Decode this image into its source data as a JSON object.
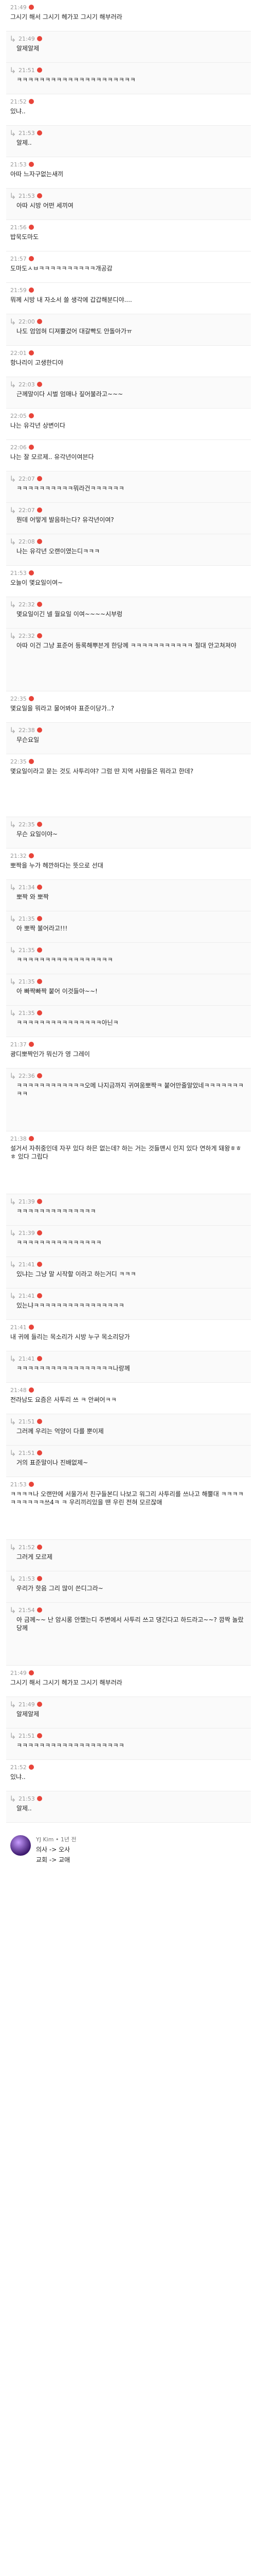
{
  "posts": [
    {
      "reply": false,
      "time": "21:49",
      "text": "그시기 해서 그시기 헤가꼬 그시기 해부러라",
      "tall": false
    },
    {
      "reply": true,
      "time": "21:49",
      "text": "알제알제",
      "tall": false
    },
    {
      "reply": true,
      "time": "21:51",
      "text": "ㅋㅋㅋㅋㅋㅋㅋㅋㅋㅋㅋㅋㅋㅋㅋㅋㅋㅋㅋㅋㅋ",
      "tall": false
    },
    {
      "reply": false,
      "time": "21:52",
      "text": "있냐..",
      "tall": false
    },
    {
      "reply": true,
      "time": "21:53",
      "text": "알제..",
      "tall": false
    },
    {
      "reply": false,
      "time": "21:53",
      "text": "아따 느자구없는새끼",
      "tall": false
    },
    {
      "reply": true,
      "time": "21:53",
      "text": "아따 시방 어떤 세끼여",
      "tall": false
    },
    {
      "reply": false,
      "time": "21:56",
      "text": "밥묵도마도",
      "tall": false
    },
    {
      "reply": false,
      "time": "21:57",
      "text": "도마도ㅅㅂㅋㅋㅋㅋㅋㅋㅋㅋㅋㅋ개공감",
      "tall": false
    },
    {
      "reply": false,
      "time": "21:59",
      "text": "뭐께 시방 내 자소서 쓸 생각에 갑갑해분디야....",
      "tall": false
    },
    {
      "reply": true,
      "time": "22:00",
      "text": "나도 엄엄혀 디져뿔겄어 대갈빡도 안돌아가ㅠ",
      "tall": false
    },
    {
      "reply": false,
      "time": "22:01",
      "text": "항나리이 고생한디야",
      "tall": false
    },
    {
      "reply": true,
      "time": "22:03",
      "text": "근께말이다 시벌 엄매나 짚어불라고~~~",
      "tall": false
    },
    {
      "reply": false,
      "time": "22:05",
      "text": "나는 유각년 상변이다",
      "tall": false
    },
    {
      "reply": false,
      "time": "22:06",
      "text": "나는 잘 모르제.. 유각년이여븐다",
      "tall": false
    },
    {
      "reply": true,
      "time": "22:07",
      "text": "ㅋㅋㅋㅋㅋㅋㅋㅋㅋㅋ뭐라건ㅋㅋㅋㅋㅋㅋ",
      "tall": false
    },
    {
      "reply": true,
      "time": "22:07",
      "text": "뭔데 어떻게 발음하는다? 유각년이여?",
      "tall": false
    },
    {
      "reply": true,
      "time": "22:08",
      "text": "나는 유각년 오랜이였는디ㅋㅋㅋ",
      "tall": false
    },
    {
      "reply": false,
      "time": "21:53",
      "text": "오늘이 몇요일이여~",
      "tall": false
    },
    {
      "reply": true,
      "time": "22:32",
      "text": "몇요일이긴 넬 월요일 이여~~~~시부렁",
      "tall": false
    },
    {
      "reply": true,
      "time": "22:32",
      "text": "아따 이건 그냥 표준어 등록해뿌븐게 한당께 ㅋㅋㅋㅋㅋㅋㅋㅋㅋㅋㅋ 절대 안고쳐져야",
      "tall": true
    },
    {
      "reply": false,
      "time": "22:35",
      "text": "몇요일을 뭐라고 물어봐야 표준이당가..?",
      "tall": false
    },
    {
      "reply": true,
      "time": "22:38",
      "text": "무슨요일",
      "tall": false
    },
    {
      "reply": false,
      "time": "22:35",
      "text": "몇요일이라고 묻는 것도 사투리야? 그럼 딴 지역 사람들은 뭐라고 한데?",
      "tall": true
    },
    {
      "reply": true,
      "time": "22:35",
      "text": "무슨 요일이야~",
      "tall": false
    },
    {
      "reply": false,
      "time": "21:32",
      "text": "뽀짝을 누가 헤깐하다는 뜻으로 선대",
      "tall": false
    },
    {
      "reply": true,
      "time": "21:34",
      "text": "뽀짝 와 뽀짝",
      "tall": false
    },
    {
      "reply": true,
      "time": "21:35",
      "text": "아 뽀짝 불어라고!!!",
      "tall": false
    },
    {
      "reply": true,
      "time": "21:35",
      "text": "ㅋㅋㅋㅋㅋㅋㅋㅋㅋㅋㅋㅋㅋㅋㅋㅋㅋ",
      "tall": false
    },
    {
      "reply": true,
      "time": "21:35",
      "text": "아 빠짝빠짝 붙어 이것들아~~!",
      "tall": false
    },
    {
      "reply": true,
      "time": "21:35",
      "text": "ㅋㅋㅋㅋㅋㅋㅋㅋㅋㅋㅋㅋㅋㅋㅋ아닌ㅋ",
      "tall": false
    },
    {
      "reply": false,
      "time": "21:37",
      "text": "광디뽀짝인가 뭐신가 영 그레이",
      "tall": false
    },
    {
      "reply": true,
      "time": "22:36",
      "text": "ㅋㅋㅋㅋㅋㅋㅋㅋㅋㅋㅋㅋ오메 나지금까지 귀여움뽀짝ㅋ 붙어만줄알았네ㅋㅋㅋㅋㅋㅋㅋㅋㅋ",
      "tall": true
    },
    {
      "reply": false,
      "time": "21:38",
      "text": "설거서 자취중인데 자꾸 있다 하믄 없는데? 하는 거는 것들맨시 인지 있다 연하게 돼왕ㅎㅎㅎ 있다 그립다",
      "tall": true
    },
    {
      "reply": true,
      "time": "21:39",
      "text": "ㅋㅋㅋㅋㅋㅋㅋㅋㅋㅋㅋㅋㅋㅋ",
      "tall": false
    },
    {
      "reply": true,
      "time": "21:39",
      "text": "ㅋㅋㅋㅋㅋㅋㅋㅋㅋㅋㅋㅋㅋㅋㅋ",
      "tall": false
    },
    {
      "reply": true,
      "time": "21:41",
      "text": "있냐는 그냥 말 시작할 이라고 하는거디 ㅋㅋㅋ",
      "tall": false
    },
    {
      "reply": true,
      "time": "21:41",
      "text": "있는냐ㅋㅋㅋㅋㅋㅋㅋㅋㅋㅋㅋㅋㅋㅋㅋㅋ",
      "tall": false
    },
    {
      "reply": false,
      "time": "21:41",
      "text": "내 귀에 들리는 목소리가 시방 누구 목소리당가",
      "tall": false
    },
    {
      "reply": true,
      "time": "21:41",
      "text": "ㅋㅋㅋㅋㅋㅋㅋㅋㅋㅋㅋㅋㅋㅋㅋㅋㅋ나랑께",
      "tall": false
    },
    {
      "reply": false,
      "time": "21:48",
      "text": "전라남도 요즘은 사투리 쓰 ㅋ 안써어ㅋㅋ",
      "tall": false
    },
    {
      "reply": true,
      "time": "21:51",
      "text": "그러께 우리는 억양이 다를 뿐이제",
      "tall": false
    },
    {
      "reply": true,
      "time": "21:51",
      "text": "거의 표준말이나 진배없제~",
      "tall": false
    },
    {
      "reply": false,
      "time": "21:53",
      "text": "ㅋㅋㅋㅋ나 오랜만에 서울가서 친구들본디 나보고 워그리 사투리를 쓰나고 해뿔대 ㅋㅋㅋㅋㅋㅋㅋㅋㅋㅋ쓰4ㅋ ㅋ 우리끼리있을 땐 우린 전혀 모르잖애",
      "tall": true
    },
    {
      "reply": true,
      "time": "21:52",
      "text": "그러게 모르제",
      "tall": false
    },
    {
      "reply": true,
      "time": "21:53",
      "text": "우리가 핫음 그리 많이 쓴디그라~",
      "tall": false
    },
    {
      "reply": true,
      "time": "21:54",
      "text": "아 금께~~ 난 암시롱 안했는디 주변에서 사투리 쓰고 댕긴다고 하드라고~~? 깜짝 놀랐당께",
      "tall": true
    },
    {
      "reply": false,
      "time": "21:49",
      "text": "그시기 해서 그시기 헤가꼬 그시기 해부러라",
      "tall": false
    },
    {
      "reply": true,
      "time": "21:49",
      "text": "알제알제",
      "tall": false
    },
    {
      "reply": true,
      "time": "21:51",
      "text": "ㅋㅋㅋㅋㅋㅋㅋㅋㅋㅋㅋㅋㅋㅋㅋㅋㅋㅋㅋ",
      "tall": false
    },
    {
      "reply": false,
      "time": "21:52",
      "text": "있냐..",
      "tall": false
    },
    {
      "reply": true,
      "time": "21:53",
      "text": "알제..",
      "tall": false
    }
  ],
  "footer": {
    "user": "YJ Kim",
    "time": "1년 전",
    "line1": "의사 -> 오사",
    "line2": "교회 -> 교애"
  }
}
